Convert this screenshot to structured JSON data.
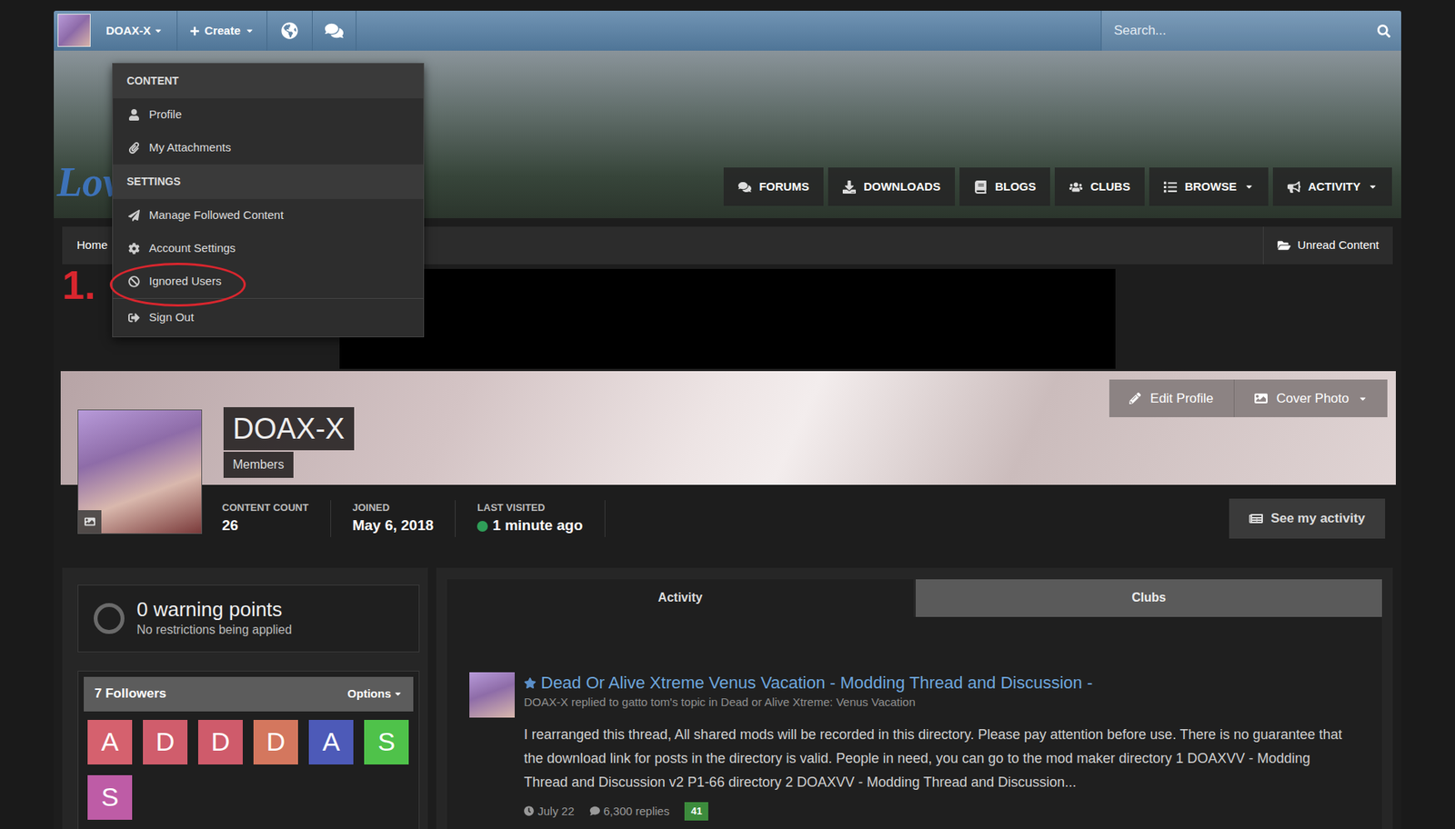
{
  "top_bar": {
    "user": {
      "label": "DOAX-X",
      "dropdown": true
    },
    "create": {
      "label": "Create",
      "dropdown": true
    },
    "search": {
      "placeholder": "Search..."
    }
  },
  "banner": {
    "logo": "Lov",
    "nav": [
      {
        "label": "FORUMS",
        "dropdown": false
      },
      {
        "label": "DOWNLOADS",
        "dropdown": false
      },
      {
        "label": "BLOGS",
        "dropdown": false
      },
      {
        "label": "CLUBS",
        "dropdown": false
      },
      {
        "label": "BROWSE",
        "dropdown": true
      },
      {
        "label": "ACTIVITY",
        "dropdown": true
      }
    ]
  },
  "breadcrumb": {
    "items": [
      "Home"
    ],
    "unread": "Unread Content"
  },
  "user_menu": {
    "sections": [
      {
        "title": "CONTENT",
        "items": [
          {
            "label": "Profile",
            "circled": false
          },
          {
            "label": "My Attachments",
            "circled": false
          }
        ]
      },
      {
        "title": "SETTINGS",
        "items": [
          {
            "label": "Manage Followed Content",
            "circled": false
          },
          {
            "label": "Account Settings",
            "circled": false
          },
          {
            "label": "Ignored Users",
            "circled": true
          }
        ]
      }
    ],
    "sign_out": "Sign Out",
    "annotation": "1."
  },
  "profile": {
    "name": "DOAX-X",
    "group": "Members",
    "buttons": [
      {
        "label": "Edit Profile",
        "dropdown": false
      },
      {
        "label": "Cover Photo",
        "dropdown": true
      }
    ],
    "stats": [
      {
        "label": "CONTENT COUNT",
        "value": "26",
        "online": false
      },
      {
        "label": "JOINED",
        "value": "May 6, 2018",
        "online": false
      },
      {
        "label": "LAST VISITED",
        "value": "1 minute ago",
        "online": true
      }
    ],
    "activity_button": "See my activity"
  },
  "warnings": {
    "title": "0 warning points",
    "subtitle": "No restrictions being applied"
  },
  "followers": {
    "title": "7 Followers",
    "options": "Options",
    "items": [
      {
        "letter": "A",
        "color": "#d5616e"
      },
      {
        "letter": "D",
        "color": "#d05d6c"
      },
      {
        "letter": "D",
        "color": "#cf5b6b"
      },
      {
        "letter": "D",
        "color": "#d4775e"
      },
      {
        "letter": "A",
        "color": "#4d5ab8"
      },
      {
        "letter": "S",
        "color": "#4fc24a"
      },
      {
        "letter": "S",
        "color": "#be5ca6"
      }
    ]
  },
  "tabs": [
    {
      "label": "Activity",
      "selected": true
    },
    {
      "label": "Clubs",
      "selected": false
    }
  ],
  "activity": [
    {
      "title": "Dead Or Alive Xtreme Venus Vacation - Modding Thread and Discussion -",
      "featured": true,
      "meta": "DOAX-X replied to gatto tom's topic in Dead or Alive Xtreme: Venus Vacation",
      "body": "I rearranged this thread, All shared mods will be recorded in this directory. Please pay attention before use. There is no guarantee that the download link for posts in the directory is valid. People in need, you can go to the mod maker directory 1 DOAXVV - Modding Thread and Discussion v2 P1-66 directory 2 DOAXVV - Modding Thread and Discussion...",
      "date": "July 22",
      "replies": "6,300 replies",
      "reactions": "41"
    }
  ]
}
